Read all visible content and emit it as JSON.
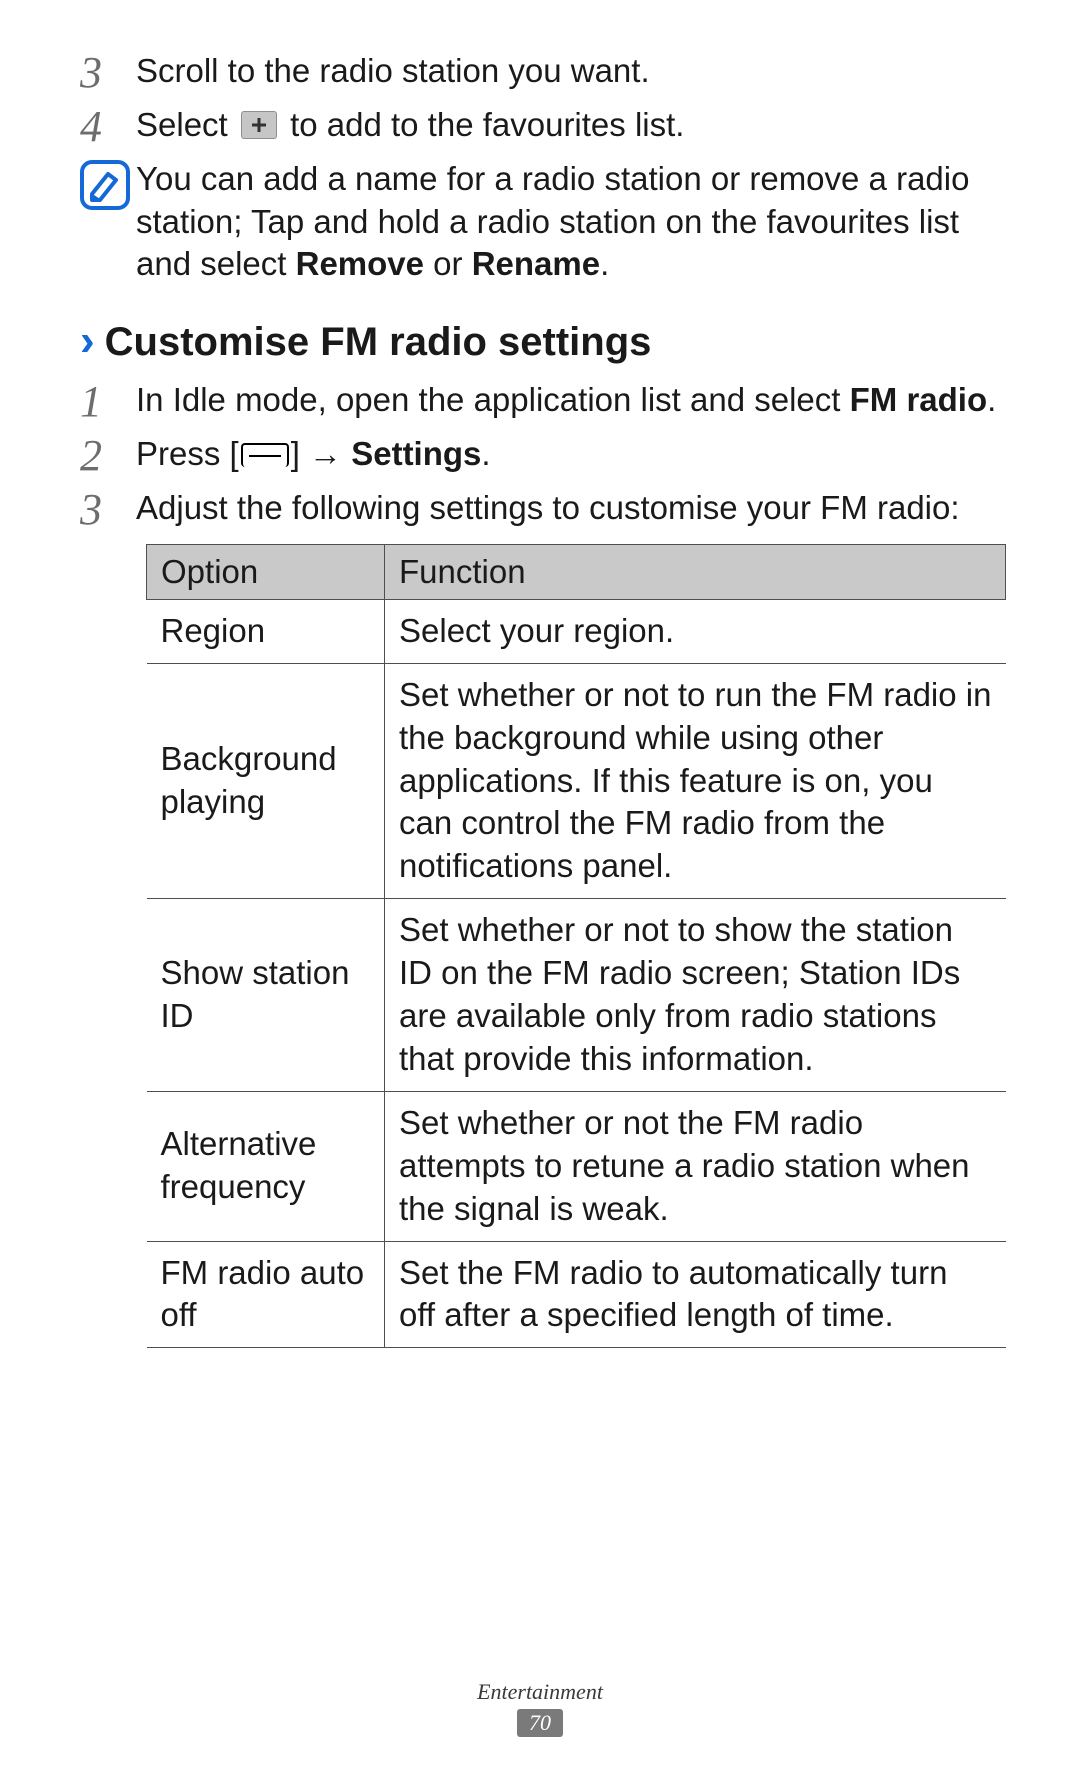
{
  "top_steps": [
    {
      "num": "3",
      "text": "Scroll to the radio station you want."
    },
    {
      "num": "4",
      "pre": "Select ",
      "post": " to add to the favourites list."
    }
  ],
  "note": {
    "text_pre": "You can add a name for a radio station or remove a radio station; Tap and hold a radio station on the favourites list and select ",
    "b1": "Remove",
    "mid": " or ",
    "b2": "Rename",
    "tail": "."
  },
  "section": {
    "chev": "›",
    "title": "Customise FM radio settings"
  },
  "section_steps": [
    {
      "num": "1",
      "pre": "In Idle mode, open the application list and select ",
      "b1": "FM radio",
      "tail": "."
    },
    {
      "num": "2",
      "pre": "Press [",
      "mid": "] → ",
      "b1": "Settings",
      "tail": "."
    },
    {
      "num": "3",
      "pre": "Adjust the following settings to customise your FM radio:"
    }
  ],
  "table": {
    "head": {
      "option": "Option",
      "function": "Function"
    },
    "rows": [
      {
        "option": "Region",
        "function": "Select your region."
      },
      {
        "option": "Background playing",
        "function": "Set whether or not to run the FM radio in the background while using other applications. If this feature is on, you can control the FM radio from the notifications panel."
      },
      {
        "option": "Show station ID",
        "function": "Set whether or not to show the station ID on the FM radio screen; Station IDs are available only from radio stations that provide this information."
      },
      {
        "option": "Alternative frequency",
        "function": "Set whether or not the FM radio attempts to retune a radio station when the signal is weak."
      },
      {
        "option": "FM radio auto off",
        "function": "Set the FM radio to automatically turn off after a specified length of time."
      }
    ]
  },
  "footer": {
    "section": "Entertainment",
    "page": "70"
  }
}
